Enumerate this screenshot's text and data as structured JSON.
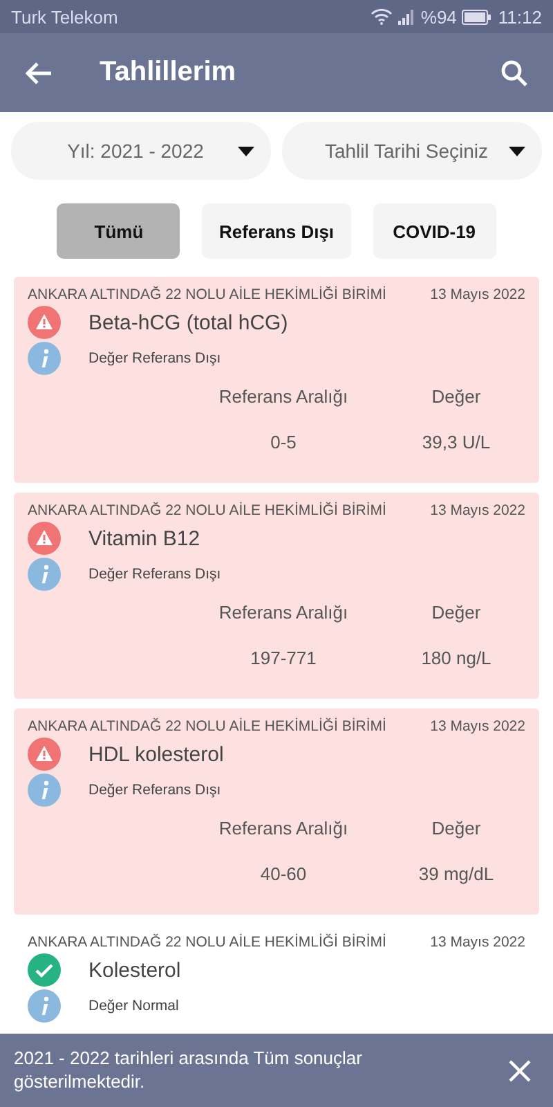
{
  "status_bar": {
    "carrier": "Turk Telekom",
    "battery": "%94",
    "time": "11:12"
  },
  "app_bar": {
    "title": "Tahlillerim"
  },
  "filters": [
    {
      "label": "Yıl: 2021 - 2022"
    },
    {
      "label": "Tahlil Tarihi Seçiniz"
    }
  ],
  "chips": [
    {
      "label": "Tümü",
      "selected": true
    },
    {
      "label": "Referans Dışı",
      "selected": false
    },
    {
      "label": "COVID-19",
      "selected": false
    }
  ],
  "results": [
    {
      "institution": "ANKARA ALTINDAĞ 22 NOLU AİLE HEKİMLİĞİ BİRİMİ",
      "date": "13 Mayıs 2022",
      "test": "Beta-hCG (total hCG)",
      "kind": "abnormal",
      "status": "Değer Referans Dışı",
      "range_label": "Referans Aralığı",
      "value_label": "Değer",
      "range": "0-5",
      "value": "39,3 U/L"
    },
    {
      "institution": "ANKARA ALTINDAĞ 22 NOLU AİLE HEKİMLİĞİ BİRİMİ",
      "date": "13 Mayıs 2022",
      "test": "Vitamin B12",
      "kind": "abnormal",
      "status": "Değer Referans Dışı",
      "range_label": "Referans Aralığı",
      "value_label": "Değer",
      "range": "197-771",
      "value": "180 ng/L"
    },
    {
      "institution": "ANKARA ALTINDAĞ 22 NOLU AİLE HEKİMLİĞİ BİRİMİ",
      "date": "13 Mayıs 2022",
      "test": "HDL kolesterol",
      "kind": "abnormal",
      "status": "Değer Referans Dışı",
      "range_label": "Referans Aralığı",
      "value_label": "Değer",
      "range": "40-60",
      "value": "39 mg/dL"
    },
    {
      "institution": "ANKARA ALTINDAĞ 22 NOLU AİLE HEKİMLİĞİ BİRİMİ",
      "date": "13 Mayıs 2022",
      "test": "Kolesterol",
      "kind": "normal",
      "status": "Değer Normal"
    }
  ],
  "snackbar": {
    "message": "2021 - 2022 tarihleri arasında Tüm sonuçlar gösterilmektedir."
  }
}
